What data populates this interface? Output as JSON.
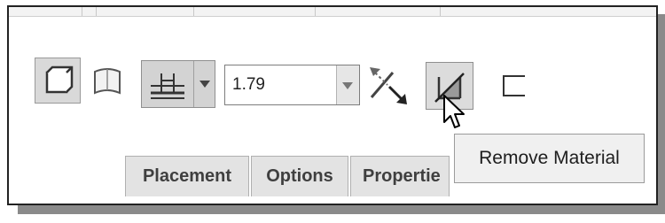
{
  "toolbar": {
    "solid_icon": "solid-extrude-icon",
    "surface_icon": "surface-extrude-icon",
    "depth_option_icon": "blind-depth-icon",
    "depth_value": "1.79",
    "flip_icon": "flip-direction-icon",
    "remove_material_icon": "remove-material-icon",
    "thicken_icon": "thicken-sketch-icon"
  },
  "tabs": [
    {
      "label": "Placement"
    },
    {
      "label": "Options"
    },
    {
      "label": "Propertie"
    }
  ],
  "tooltip": {
    "text": "Remove Material"
  },
  "colors": {
    "button_active": "#d9d9d9",
    "border": "#222222",
    "shadow": "#8a8a8a"
  }
}
